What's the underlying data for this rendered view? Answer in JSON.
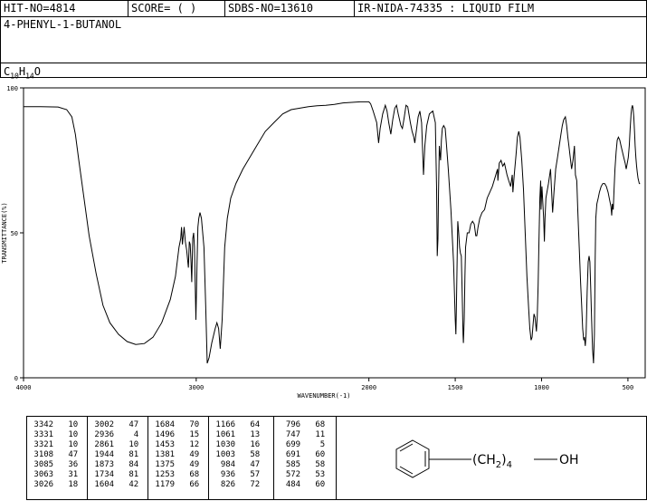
{
  "header": {
    "hit_no": "HIT-NO=4814",
    "score": "SCORE=  (   )",
    "sdbs_no": "SDBS-NO=13610",
    "ir_info": "IR-NIDA-74335 : LIQUID FILM"
  },
  "compound": {
    "name": "4-PHENYL-1-BUTANOL",
    "formula": {
      "c": "C",
      "c_sub": "10",
      "h": "H",
      "h_sub": "14",
      "o": "O"
    }
  },
  "chart_data": {
    "type": "line",
    "xlabel": "WAVENUMBER(-1)",
    "ylabel": "TRANSMITTANCE(%)",
    "xlim": [
      4000,
      400
    ],
    "ylim": [
      0,
      100
    ],
    "x_ticks": [
      4000,
      3000,
      2000,
      1500,
      1000,
      500
    ],
    "y_ticks": [
      0,
      50,
      100
    ],
    "series": [
      {
        "points": [
          [
            4000,
            93.5
          ],
          [
            3900,
            93.5
          ],
          [
            3800,
            93.4
          ],
          [
            3750,
            92.5
          ],
          [
            3720,
            90
          ],
          [
            3700,
            84
          ],
          [
            3680,
            75
          ],
          [
            3650,
            62
          ],
          [
            3620,
            49
          ],
          [
            3580,
            36
          ],
          [
            3540,
            25
          ],
          [
            3500,
            19
          ],
          [
            3450,
            15
          ],
          [
            3400,
            12.5
          ],
          [
            3350,
            11.5
          ],
          [
            3300,
            11.8
          ],
          [
            3250,
            14
          ],
          [
            3200,
            19
          ],
          [
            3150,
            27
          ],
          [
            3120,
            35
          ],
          [
            3100,
            45
          ],
          [
            3090,
            48
          ],
          [
            3085,
            52
          ],
          [
            3080,
            46
          ],
          [
            3070,
            52
          ],
          [
            3063,
            47
          ],
          [
            3055,
            44
          ],
          [
            3045,
            38
          ],
          [
            3040,
            47
          ],
          [
            3035,
            46
          ],
          [
            3030,
            40
          ],
          [
            3026,
            33
          ],
          [
            3020,
            48
          ],
          [
            3015,
            50
          ],
          [
            3010,
            45
          ],
          [
            3002,
            20
          ],
          [
            2995,
            40
          ],
          [
            2990,
            52
          ],
          [
            2985,
            55
          ],
          [
            2978,
            57
          ],
          [
            2970,
            55
          ],
          [
            2955,
            45
          ],
          [
            2945,
            25
          ],
          [
            2936,
            5
          ],
          [
            2925,
            7
          ],
          [
            2910,
            12
          ],
          [
            2890,
            17
          ],
          [
            2880,
            19
          ],
          [
            2870,
            17
          ],
          [
            2861,
            10
          ],
          [
            2850,
            20
          ],
          [
            2835,
            45
          ],
          [
            2820,
            55
          ],
          [
            2800,
            62
          ],
          [
            2770,
            67
          ],
          [
            2730,
            72
          ],
          [
            2700,
            75
          ],
          [
            2650,
            80
          ],
          [
            2600,
            85
          ],
          [
            2550,
            88
          ],
          [
            2500,
            91
          ],
          [
            2450,
            92.5
          ],
          [
            2400,
            93
          ],
          [
            2350,
            93.5
          ],
          [
            2300,
            93.8
          ],
          [
            2250,
            94
          ],
          [
            2200,
            94.3
          ],
          [
            2150,
            94.8
          ],
          [
            2100,
            95
          ],
          [
            2050,
            95.2
          ],
          [
            2000,
            95.2
          ],
          [
            1990,
            94.5
          ],
          [
            1975,
            92
          ],
          [
            1955,
            88
          ],
          [
            1944,
            81
          ],
          [
            1935,
            86
          ],
          [
            1920,
            91
          ],
          [
            1905,
            94
          ],
          [
            1895,
            92
          ],
          [
            1885,
            88
          ],
          [
            1873,
            84
          ],
          [
            1862,
            89
          ],
          [
            1850,
            93
          ],
          [
            1840,
            94
          ],
          [
            1830,
            91
          ],
          [
            1815,
            87
          ],
          [
            1806,
            86
          ],
          [
            1795,
            90
          ],
          [
            1785,
            94
          ],
          [
            1775,
            93.5
          ],
          [
            1760,
            88
          ],
          [
            1750,
            85
          ],
          [
            1740,
            83
          ],
          [
            1734,
            81
          ],
          [
            1728,
            84
          ],
          [
            1715,
            90
          ],
          [
            1705,
            92
          ],
          [
            1695,
            88
          ],
          [
            1684,
            70
          ],
          [
            1676,
            80
          ],
          [
            1665,
            87
          ],
          [
            1650,
            91
          ],
          [
            1630,
            92
          ],
          [
            1615,
            88
          ],
          [
            1608,
            65
          ],
          [
            1604,
            42
          ],
          [
            1600,
            48
          ],
          [
            1597,
            64
          ],
          [
            1592,
            80
          ],
          [
            1588,
            77
          ],
          [
            1585,
            75
          ],
          [
            1580,
            82
          ],
          [
            1575,
            86
          ],
          [
            1567,
            87
          ],
          [
            1558,
            86
          ],
          [
            1550,
            80
          ],
          [
            1540,
            72
          ],
          [
            1525,
            58
          ],
          [
            1510,
            40
          ],
          [
            1500,
            20
          ],
          [
            1496,
            15
          ],
          [
            1493,
            25
          ],
          [
            1488,
            45
          ],
          [
            1485,
            54
          ],
          [
            1480,
            50
          ],
          [
            1475,
            45
          ],
          [
            1470,
            43
          ],
          [
            1465,
            42
          ],
          [
            1460,
            30
          ],
          [
            1455,
            15
          ],
          [
            1453,
            12
          ],
          [
            1448,
            20
          ],
          [
            1444,
            35
          ],
          [
            1440,
            45
          ],
          [
            1430,
            50
          ],
          [
            1420,
            50
          ],
          [
            1410,
            53
          ],
          [
            1400,
            54
          ],
          [
            1390,
            53
          ],
          [
            1381,
            49
          ],
          [
            1375,
            49
          ],
          [
            1368,
            52
          ],
          [
            1358,
            55
          ],
          [
            1345,
            57
          ],
          [
            1330,
            58
          ],
          [
            1315,
            62
          ],
          [
            1300,
            64
          ],
          [
            1285,
            66
          ],
          [
            1270,
            69
          ],
          [
            1255,
            72
          ],
          [
            1253,
            68
          ],
          [
            1245,
            74
          ],
          [
            1235,
            75
          ],
          [
            1225,
            73
          ],
          [
            1215,
            74
          ],
          [
            1200,
            70
          ],
          [
            1190,
            68
          ],
          [
            1179,
            66
          ],
          [
            1170,
            70
          ],
          [
            1166,
            64
          ],
          [
            1158,
            70
          ],
          [
            1148,
            77
          ],
          [
            1140,
            83
          ],
          [
            1132,
            85
          ],
          [
            1125,
            83
          ],
          [
            1115,
            75
          ],
          [
            1105,
            65
          ],
          [
            1095,
            50
          ],
          [
            1085,
            35
          ],
          [
            1075,
            24
          ],
          [
            1068,
            17
          ],
          [
            1061,
            13
          ],
          [
            1055,
            14
          ],
          [
            1050,
            18
          ],
          [
            1044,
            22
          ],
          [
            1038,
            21
          ],
          [
            1030,
            16
          ],
          [
            1025,
            21
          ],
          [
            1020,
            32
          ],
          [
            1015,
            47
          ],
          [
            1010,
            62
          ],
          [
            1005,
            68
          ],
          [
            1003,
            58
          ],
          [
            998,
            66
          ],
          [
            994,
            62
          ],
          [
            988,
            55
          ],
          [
            984,
            47
          ],
          [
            980,
            55
          ],
          [
            975,
            62
          ],
          [
            960,
            67
          ],
          [
            948,
            72
          ],
          [
            936,
            57
          ],
          [
            928,
            64
          ],
          [
            918,
            72
          ],
          [
            908,
            76
          ],
          [
            898,
            80
          ],
          [
            888,
            84
          ],
          [
            880,
            87
          ],
          [
            872,
            89
          ],
          [
            862,
            90
          ],
          [
            855,
            87
          ],
          [
            848,
            83
          ],
          [
            842,
            80
          ],
          [
            836,
            77
          ],
          [
            826,
            72
          ],
          [
            818,
            75
          ],
          [
            810,
            80
          ],
          [
            804,
            70
          ],
          [
            796,
            68
          ],
          [
            790,
            57
          ],
          [
            782,
            45
          ],
          [
            774,
            33
          ],
          [
            768,
            25
          ],
          [
            762,
            17
          ],
          [
            756,
            13
          ],
          [
            752,
            14
          ],
          [
            747,
            11
          ],
          [
            742,
            15
          ],
          [
            736,
            30
          ],
          [
            730,
            40
          ],
          [
            725,
            42
          ],
          [
            720,
            40
          ],
          [
            715,
            30
          ],
          [
            710,
            20
          ],
          [
            705,
            10
          ],
          [
            699,
            5
          ],
          [
            694,
            15
          ],
          [
            690,
            40
          ],
          [
            686,
            55
          ],
          [
            680,
            60
          ],
          [
            672,
            62
          ],
          [
            665,
            64
          ],
          [
            655,
            66
          ],
          [
            645,
            67
          ],
          [
            635,
            67
          ],
          [
            625,
            66
          ],
          [
            615,
            64
          ],
          [
            605,
            61
          ],
          [
            598,
            59
          ],
          [
            594,
            56
          ],
          [
            590,
            60
          ],
          [
            585,
            58
          ],
          [
            580,
            65
          ],
          [
            575,
            72
          ],
          [
            568,
            78
          ],
          [
            562,
            82
          ],
          [
            555,
            83
          ],
          [
            547,
            82
          ],
          [
            540,
            80
          ],
          [
            532,
            78
          ],
          [
            524,
            76
          ],
          [
            516,
            74
          ],
          [
            510,
            72
          ],
          [
            504,
            74
          ],
          [
            498,
            76
          ],
          [
            492,
            80
          ],
          [
            487,
            86
          ],
          [
            482,
            91
          ],
          [
            478,
            93
          ],
          [
            474,
            94
          ],
          [
            470,
            93
          ],
          [
            466,
            90
          ],
          [
            462,
            85
          ],
          [
            458,
            80
          ],
          [
            454,
            76
          ],
          [
            450,
            73
          ],
          [
            446,
            71
          ],
          [
            442,
            69
          ],
          [
            438,
            68
          ],
          [
            434,
            67
          ],
          [
            430,
            67
          ]
        ]
      }
    ]
  },
  "peak_table": {
    "columns": [
      [
        [
          "3342",
          "10"
        ],
        [
          "3331",
          "10"
        ],
        [
          "3321",
          "10"
        ],
        [
          "3108",
          "47"
        ],
        [
          "3085",
          "36"
        ],
        [
          "3063",
          "31"
        ],
        [
          "3026",
          "18"
        ]
      ],
      [
        [
          "3002",
          "47"
        ],
        [
          "2936",
          "4"
        ],
        [
          "2861",
          "10"
        ],
        [
          "1944",
          "81"
        ],
        [
          "1873",
          "84"
        ],
        [
          "1734",
          "81"
        ],
        [
          "1604",
          "42"
        ]
      ],
      [
        [
          "1684",
          "70"
        ],
        [
          "1496",
          "15"
        ],
        [
          "1453",
          "12"
        ],
        [
          "1381",
          "49"
        ],
        [
          "1375",
          "49"
        ],
        [
          "1253",
          "68"
        ],
        [
          "1179",
          "66"
        ]
      ],
      [
        [
          "1166",
          "64"
        ],
        [
          "1061",
          "13"
        ],
        [
          "1030",
          "16"
        ],
        [
          "1003",
          "58"
        ],
        [
          "984",
          "47"
        ],
        [
          "936",
          "57"
        ],
        [
          "826",
          "72"
        ]
      ],
      [
        [
          "796",
          "68"
        ],
        [
          "747",
          "11"
        ],
        [
          "699",
          "5"
        ],
        [
          "691",
          "60"
        ],
        [
          "585",
          "58"
        ],
        [
          "572",
          "53"
        ],
        [
          "484",
          "60"
        ]
      ]
    ]
  },
  "structure": {
    "substituent_label": "(CH",
    "sub2": "2",
    "close": ")",
    "sub4": "4",
    "oh": "OH"
  }
}
